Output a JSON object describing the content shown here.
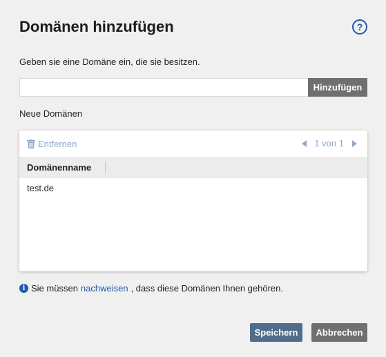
{
  "dialog": {
    "title": "Domänen hinzufügen",
    "help_icon": "help-circle-icon",
    "help_glyph": "?",
    "intro": "Geben sie eine Domäne ein, die sie besitzen.",
    "domain_input": {
      "value": "",
      "placeholder": ""
    },
    "add_button": "Hinzufügen",
    "new_domains_label": "Neue Domänen"
  },
  "grid": {
    "remove_button": "Entfernen",
    "remove_icon": "trash-icon",
    "pager": {
      "text": "1 von 1"
    },
    "columns": [
      "Domänenname"
    ],
    "rows": [
      {
        "name": "test.de"
      }
    ]
  },
  "info": {
    "icon": "info-icon",
    "icon_glyph": "i",
    "before": "Sie müssen",
    "link": "nachweisen",
    "after": ", dass diese Domänen Ihnen gehören."
  },
  "footer": {
    "save_button": "Speichern",
    "cancel_button": "Abbrechen"
  },
  "colors": {
    "accent": "#1f5aa6",
    "primary_button": "#4f6d8a",
    "secondary_button": "#6f6f6f",
    "disabled_text": "#8fa9c9"
  }
}
